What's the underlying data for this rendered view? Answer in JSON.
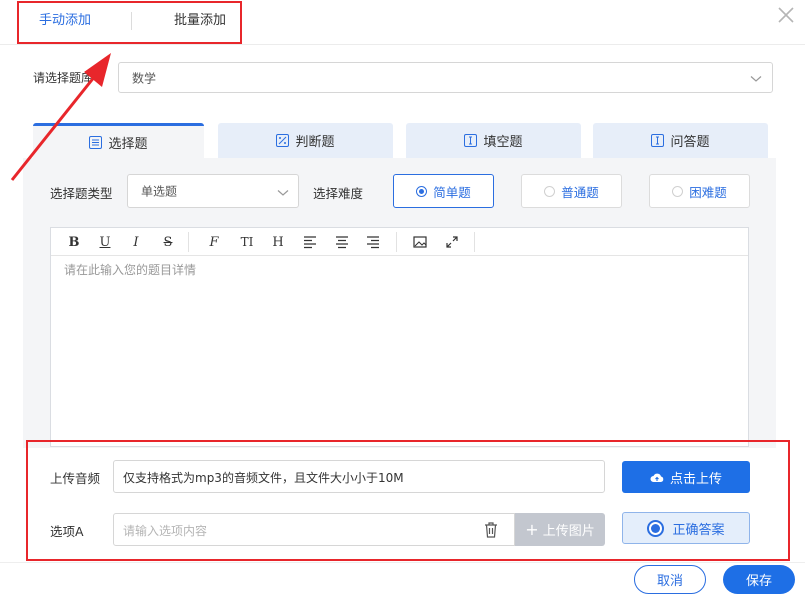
{
  "top_tabs": {
    "manual": "手动添加",
    "batch": "批量添加"
  },
  "category": {
    "label": "请选择题库",
    "selected": "数学"
  },
  "question_tabs": [
    {
      "label": "选择题",
      "icon": "list-icon",
      "active": true
    },
    {
      "label": "判断题",
      "icon": "percent-icon",
      "active": false
    },
    {
      "label": "填空题",
      "icon": "text-cursor-icon",
      "active": false
    },
    {
      "label": "问答题",
      "icon": "text-cursor-icon",
      "active": false
    }
  ],
  "choice_type": {
    "label": "选择题类型",
    "selected": "单选题"
  },
  "difficulty": {
    "label": "选择难度",
    "options": [
      "简单题",
      "普通题",
      "困难题"
    ],
    "selected": "简单题"
  },
  "editor": {
    "toolbar": [
      "B",
      "U",
      "I",
      "S",
      "F",
      "TI",
      "H",
      "align-left",
      "align-center",
      "align-right",
      "image",
      "fullscreen"
    ],
    "placeholder": "请在此输入您的题目详情"
  },
  "audio": {
    "label": "上传音频",
    "hint": "仅支持格式为mp3的音频文件，且文件大小小于10M",
    "button": "点击上传"
  },
  "option_a": {
    "label": "选项A",
    "placeholder": "请输入选项内容",
    "upload_image": "上传图片",
    "correct": "正确答案"
  },
  "footer": {
    "cancel": "取消",
    "save": "保存"
  },
  "colors": {
    "accent": "#1e6fe6",
    "annotation": "#e8262b",
    "tab_bg": "#e7eef9"
  }
}
